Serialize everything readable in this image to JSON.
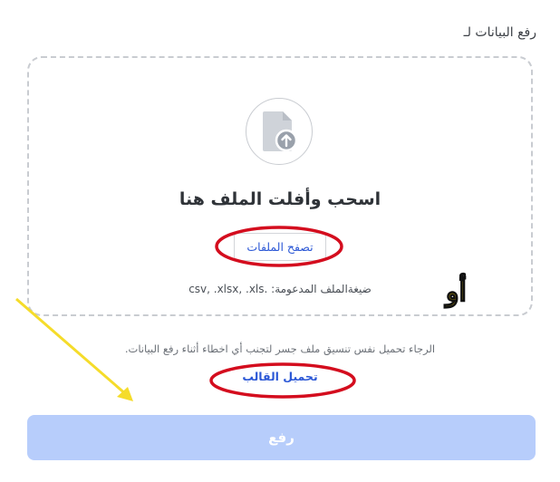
{
  "dialog": {
    "title": "رفع البيانات لـ"
  },
  "dropzone": {
    "icon": "file-upload-icon",
    "heading": "اسحب وأفلت الملف هنا",
    "browse_label": "تصفح الملفات",
    "supported_formats": "ضيغةالملف المدعومة: .csv, .xlsx, .xls"
  },
  "note": {
    "text": "الرجاء تحميل نفس تنسيق ملف جسر لتجنب أي اخطاء أثناء رفع البيانات.",
    "template_link": "تحميل القالب"
  },
  "footer": {
    "upload_label": "رفع"
  },
  "annotations": {
    "or_label": "أو",
    "circle_color": "#d40d1e",
    "arrow_color": "#f5dc2a"
  },
  "colors": {
    "accent": "#2c58d6",
    "upload_button": "#b7cdfb"
  }
}
